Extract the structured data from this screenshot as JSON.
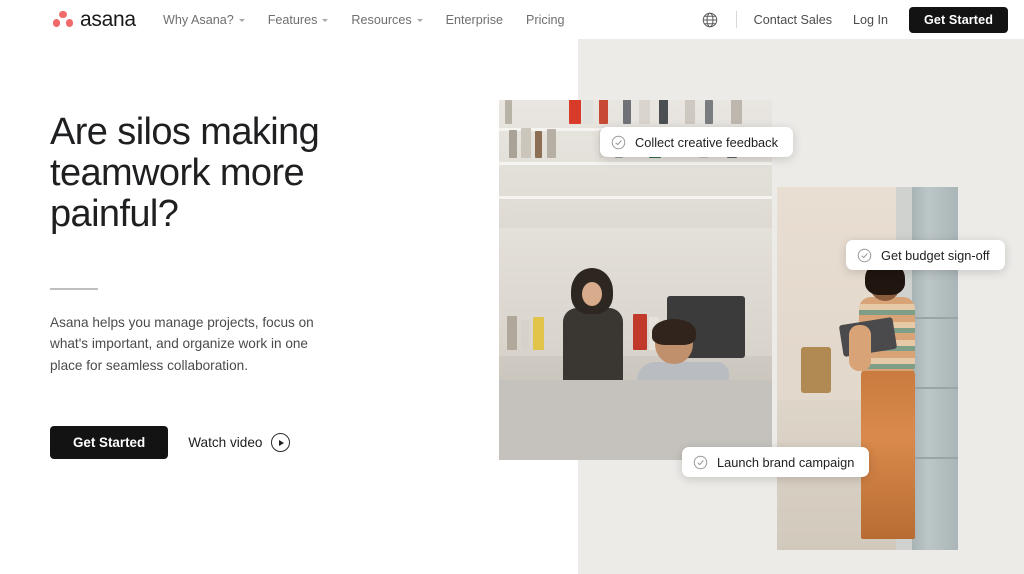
{
  "nav": {
    "logo_text": "asana",
    "logo_icon": "asana-dots-logo",
    "links": [
      {
        "label": "Why Asana?",
        "has_caret": true
      },
      {
        "label": "Features",
        "has_caret": true
      },
      {
        "label": "Resources",
        "has_caret": true
      },
      {
        "label": "Enterprise",
        "has_caret": false
      },
      {
        "label": "Pricing",
        "has_caret": false
      }
    ],
    "language_icon": "globe-icon",
    "contact_sales": "Contact Sales",
    "log_in": "Log In",
    "get_started": "Get Started"
  },
  "hero": {
    "headline": "Are silos making teamwork more painful?",
    "subtext": "Asana helps you manage projects, focus on what's important, and organize work in one place for seamless collaboration.",
    "primary_cta": "Get Started",
    "secondary_cta": "Watch video",
    "play_icon": "play-icon"
  },
  "collage": {
    "pills": [
      {
        "label": "Collect creative feedback",
        "icon": "check-circle-icon"
      },
      {
        "label": "Get budget sign-off",
        "icon": "check-circle-icon"
      },
      {
        "label": "Launch brand campaign",
        "icon": "check-circle-icon"
      }
    ],
    "photos": [
      {
        "alt": "two coworkers at a desk in front of a bookshelf"
      },
      {
        "alt": "woman holding a laptop in an office hallway"
      }
    ]
  },
  "colors": {
    "brand_coral": "#F06A6A",
    "text_dark": "#1E1F21",
    "text_muted": "#6F6F6F",
    "button_dark": "#131313",
    "panel_gray": "#EDEBE8"
  }
}
